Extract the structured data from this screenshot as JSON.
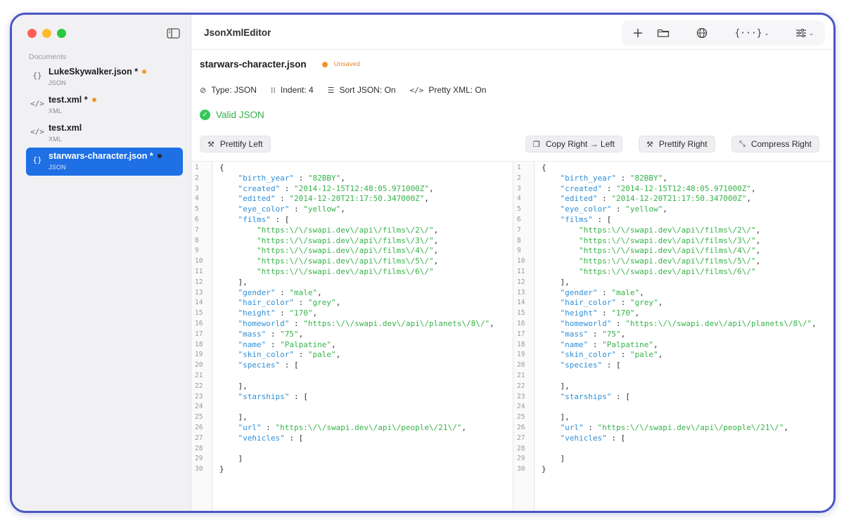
{
  "app": {
    "title": "JsonXmlEditor"
  },
  "sidebar": {
    "section_label": "Documents",
    "items": [
      {
        "name": "LukeSkywalker.json *",
        "type": "JSON",
        "icon": "{}",
        "unsaved": true,
        "active": false
      },
      {
        "name": "test.xml *",
        "type": "XML",
        "icon": "</>",
        "unsaved": true,
        "active": false
      },
      {
        "name": "test.xml",
        "type": "XML",
        "icon": "</>",
        "unsaved": false,
        "active": false
      },
      {
        "name": "starwars-character.json *",
        "type": "JSON",
        "icon": "{}",
        "unsaved": true,
        "active": true
      }
    ]
  },
  "toolbar": {
    "icons": [
      "plus-icon",
      "folder-icon",
      "globe-icon",
      "braces-menu-icon",
      "sliders-menu-icon"
    ]
  },
  "file": {
    "name": "starwars-character.json",
    "status": "Unsaved"
  },
  "meta": {
    "type": "Type: JSON",
    "indent": "Indent: 4",
    "sort": "Sort JSON: On",
    "pretty_xml": "Pretty XML: On"
  },
  "validation": {
    "label": "Valid JSON"
  },
  "buttons": {
    "prettify_left": "Prettify Left",
    "copy_right_left": "Copy Right → Left",
    "prettify_right": "Prettify Right",
    "compress_right": "Compress Right"
  },
  "code": [
    [
      [
        "p",
        "{"
      ]
    ],
    [
      [
        "p",
        "    "
      ],
      [
        "k",
        "\"birth_year\""
      ],
      [
        "p",
        " : "
      ],
      [
        "s",
        "\"82BBY\""
      ],
      [
        "p",
        ","
      ]
    ],
    [
      [
        "p",
        "    "
      ],
      [
        "k",
        "\"created\""
      ],
      [
        "p",
        " : "
      ],
      [
        "s",
        "\"2014-12-15T12:48:05.971000Z\""
      ],
      [
        "p",
        ","
      ]
    ],
    [
      [
        "p",
        "    "
      ],
      [
        "k",
        "\"edited\""
      ],
      [
        "p",
        " : "
      ],
      [
        "s",
        "\"2014-12-20T21:17:50.347000Z\""
      ],
      [
        "p",
        ","
      ]
    ],
    [
      [
        "p",
        "    "
      ],
      [
        "k",
        "\"eye_color\""
      ],
      [
        "p",
        " : "
      ],
      [
        "s",
        "\"yellow\""
      ],
      [
        "p",
        ","
      ]
    ],
    [
      [
        "p",
        "    "
      ],
      [
        "k",
        "\"films\""
      ],
      [
        "p",
        " : ["
      ]
    ],
    [
      [
        "p",
        "        "
      ],
      [
        "s",
        "\"https:\\/\\/swapi.dev\\/api\\/films\\/2\\/\""
      ],
      [
        "p",
        ","
      ]
    ],
    [
      [
        "p",
        "        "
      ],
      [
        "s",
        "\"https:\\/\\/swapi.dev\\/api\\/films\\/3\\/\""
      ],
      [
        "p",
        ","
      ]
    ],
    [
      [
        "p",
        "        "
      ],
      [
        "s",
        "\"https:\\/\\/swapi.dev\\/api\\/films\\/4\\/\""
      ],
      [
        "p",
        ","
      ]
    ],
    [
      [
        "p",
        "        "
      ],
      [
        "s",
        "\"https:\\/\\/swapi.dev\\/api\\/films\\/5\\/\""
      ],
      [
        "p",
        ","
      ]
    ],
    [
      [
        "p",
        "        "
      ],
      [
        "s",
        "\"https:\\/\\/swapi.dev\\/api\\/films\\/6\\/\""
      ]
    ],
    [
      [
        "p",
        "    ],"
      ]
    ],
    [
      [
        "p",
        "    "
      ],
      [
        "k",
        "\"gender\""
      ],
      [
        "p",
        " : "
      ],
      [
        "s",
        "\"male\""
      ],
      [
        "p",
        ","
      ]
    ],
    [
      [
        "p",
        "    "
      ],
      [
        "k",
        "\"hair_color\""
      ],
      [
        "p",
        " : "
      ],
      [
        "s",
        "\"grey\""
      ],
      [
        "p",
        ","
      ]
    ],
    [
      [
        "p",
        "    "
      ],
      [
        "k",
        "\"height\""
      ],
      [
        "p",
        " : "
      ],
      [
        "s",
        "\"170\""
      ],
      [
        "p",
        ","
      ]
    ],
    [
      [
        "p",
        "    "
      ],
      [
        "k",
        "\"homeworld\""
      ],
      [
        "p",
        " : "
      ],
      [
        "s",
        "\"https:\\/\\/swapi.dev\\/api\\/planets\\/8\\/\""
      ],
      [
        "p",
        ","
      ]
    ],
    [
      [
        "p",
        "    "
      ],
      [
        "k",
        "\"mass\""
      ],
      [
        "p",
        " : "
      ],
      [
        "s",
        "\"75\""
      ],
      [
        "p",
        ","
      ]
    ],
    [
      [
        "p",
        "    "
      ],
      [
        "k",
        "\"name\""
      ],
      [
        "p",
        " : "
      ],
      [
        "s",
        "\"Palpatine\""
      ],
      [
        "p",
        ","
      ]
    ],
    [
      [
        "p",
        "    "
      ],
      [
        "k",
        "\"skin_color\""
      ],
      [
        "p",
        " : "
      ],
      [
        "s",
        "\"pale\""
      ],
      [
        "p",
        ","
      ]
    ],
    [
      [
        "p",
        "    "
      ],
      [
        "k",
        "\"species\""
      ],
      [
        "p",
        " : ["
      ]
    ],
    [
      [
        "p",
        ""
      ]
    ],
    [
      [
        "p",
        "    ],"
      ]
    ],
    [
      [
        "p",
        "    "
      ],
      [
        "k",
        "\"starships\""
      ],
      [
        "p",
        " : ["
      ]
    ],
    [
      [
        "p",
        ""
      ]
    ],
    [
      [
        "p",
        "    ],"
      ]
    ],
    [
      [
        "p",
        "    "
      ],
      [
        "k",
        "\"url\""
      ],
      [
        "p",
        " : "
      ],
      [
        "s",
        "\"https:\\/\\/swapi.dev\\/api\\/people\\/21\\/\""
      ],
      [
        "p",
        ","
      ]
    ],
    [
      [
        "p",
        "    "
      ],
      [
        "k",
        "\"vehicles\""
      ],
      [
        "p",
        " : ["
      ]
    ],
    [
      [
        "p",
        ""
      ]
    ],
    [
      [
        "p",
        "    ]"
      ]
    ],
    [
      [
        "p",
        "}"
      ]
    ]
  ]
}
